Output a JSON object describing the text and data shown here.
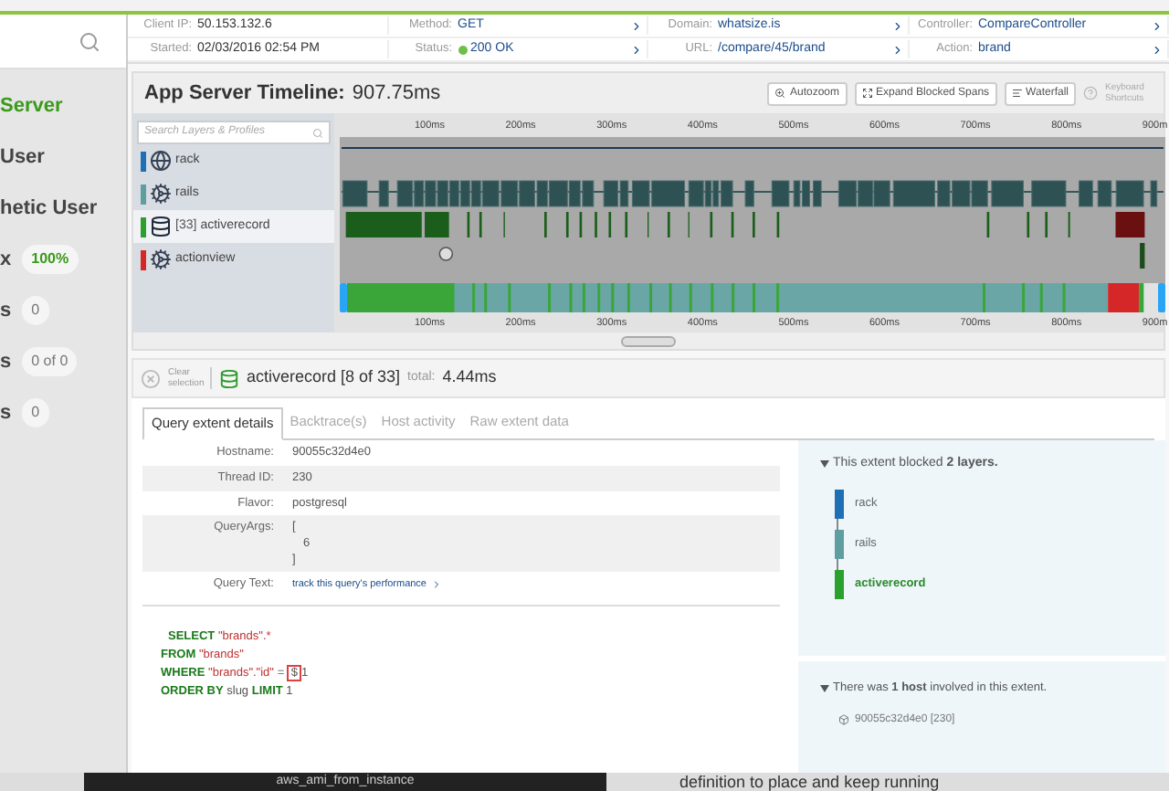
{
  "sidebar": {
    "items": [
      {
        "label": "Server",
        "selected": true
      },
      {
        "label": "User",
        "selected": false
      },
      {
        "label": "hetic User",
        "selected": false
      },
      {
        "label": "x",
        "selected": false,
        "badge": "100%",
        "kind": "success"
      },
      {
        "label": "s",
        "selected": false,
        "badge": "0",
        "kind": "count"
      },
      {
        "label": "s",
        "selected": false,
        "badge": "0 of 0",
        "kind": "count"
      },
      {
        "label": "s",
        "selected": false,
        "badge": "0",
        "kind": "count"
      }
    ]
  },
  "request_info": [
    [
      {
        "label": "Client IP:",
        "value": "50.153.132.6",
        "link": false,
        "kind": "text"
      },
      {
        "label": "Method:",
        "value": "GET",
        "link": true,
        "kind": "text"
      },
      {
        "label": "Domain:",
        "value": "whatsize.is",
        "link": true,
        "kind": "text"
      },
      {
        "label": "Controller:",
        "value": "CompareController",
        "link": true,
        "kind": "text"
      }
    ],
    [
      {
        "label": "Started:",
        "value": "02/03/2016 02:54 PM",
        "link": false,
        "kind": "text"
      },
      {
        "label": "Status:",
        "value": "200 OK",
        "link": true,
        "kind": "status"
      },
      {
        "label": "URL:",
        "value": "/compare/45/brand",
        "link": true,
        "kind": "text"
      },
      {
        "label": "Action:",
        "value": "brand",
        "link": true,
        "kind": "text"
      }
    ]
  ],
  "timeline": {
    "title": "App Server Timeline:",
    "duration": "907.75ms",
    "buttons": [
      "Autozoom",
      "Expand Blocked Spans",
      "Waterfall"
    ],
    "shortcuts": "Keyboard Shortcuts",
    "search": {
      "placeholder": "Search Layers & Profiles"
    },
    "layers": [
      {
        "name": "rack",
        "color": "#1f6fb5",
        "selected": false,
        "kind": "globe"
      },
      {
        "name": "rails",
        "color": "#5f9ea0",
        "selected": false,
        "kind": "gears"
      },
      {
        "name": "activerecord",
        "count": "[33]",
        "color": "#2ca02c",
        "selected": true,
        "kind": "database"
      },
      {
        "name": "actionview",
        "color": "#d62728",
        "selected": false,
        "kind": "gears"
      }
    ],
    "ticks_top": [
      "100ms",
      "200ms",
      "300ms",
      "400ms",
      "500ms",
      "600ms",
      "700ms",
      "800ms",
      "900m"
    ],
    "ticks_bottom": [
      "100ms",
      "200ms",
      "300ms",
      "400ms",
      "500ms",
      "600ms",
      "700ms",
      "800ms",
      "900m"
    ]
  },
  "selection": {
    "clear": "Clear selection",
    "name": "activerecord [8 of 33]",
    "total_label": "total:",
    "total": "4.44ms"
  },
  "tabs": [
    {
      "label": "Query extent details",
      "selected": true
    },
    {
      "label": "Backtrace(s)",
      "selected": false
    },
    {
      "label": "Host activity",
      "selected": false
    },
    {
      "label": "Raw extent data",
      "selected": false
    }
  ],
  "details": [
    {
      "label": "Hostname:",
      "kind": "text",
      "value": "90055c32d4e0"
    },
    {
      "label": "Thread ID:",
      "kind": "text",
      "value": "230"
    },
    {
      "label": "Flavor:",
      "kind": "text",
      "value": "postgresql"
    },
    {
      "label": "QueryArgs:",
      "kind": "lines",
      "lines": [
        "[",
        "6",
        "]"
      ]
    },
    {
      "label": "Query Text:",
      "kind": "link",
      "value": "track this query's performance"
    }
  ],
  "sql": [
    [
      {
        "kind": "keyword",
        "text": "SELECT"
      },
      {
        "kind": "string",
        "text": "\"brands\".*"
      }
    ],
    [
      {
        "kind": "keyword",
        "text": "FROM"
      },
      {
        "kind": "string",
        "text": "\"brands\""
      }
    ],
    [
      {
        "kind": "keyword",
        "text": "WHERE"
      },
      {
        "kind": "string",
        "text": "\"brands\".\"id\""
      },
      {
        "kind": "plain",
        "text": "="
      },
      {
        "kind": "marked",
        "text": "$"
      },
      {
        "kind": "plain",
        "text": "1"
      }
    ],
    [
      {
        "kind": "keyword",
        "text": "ORDER BY"
      },
      {
        "kind": "plain",
        "text": "slug"
      },
      {
        "kind": "keyword",
        "text": "LIMIT"
      },
      {
        "kind": "plain",
        "text": "1"
      }
    ]
  ],
  "blocked": {
    "text": "This extent blocked **2 layers.**",
    "layers": [
      {
        "name": "rack",
        "color": "#1f6fb5",
        "selected": false
      },
      {
        "name": "rails",
        "color": "#5f9ea0",
        "selected": false
      },
      {
        "name": "activerecord",
        "color": "#2ca02c",
        "selected": true
      }
    ]
  },
  "hosts": {
    "text": "There was **1 host** involved in this extent.",
    "host": "90055c32d4e0 [230]"
  },
  "overlay": {
    "tab": "aws_ami_from_instance",
    "text": "definition to place and keep running"
  }
}
